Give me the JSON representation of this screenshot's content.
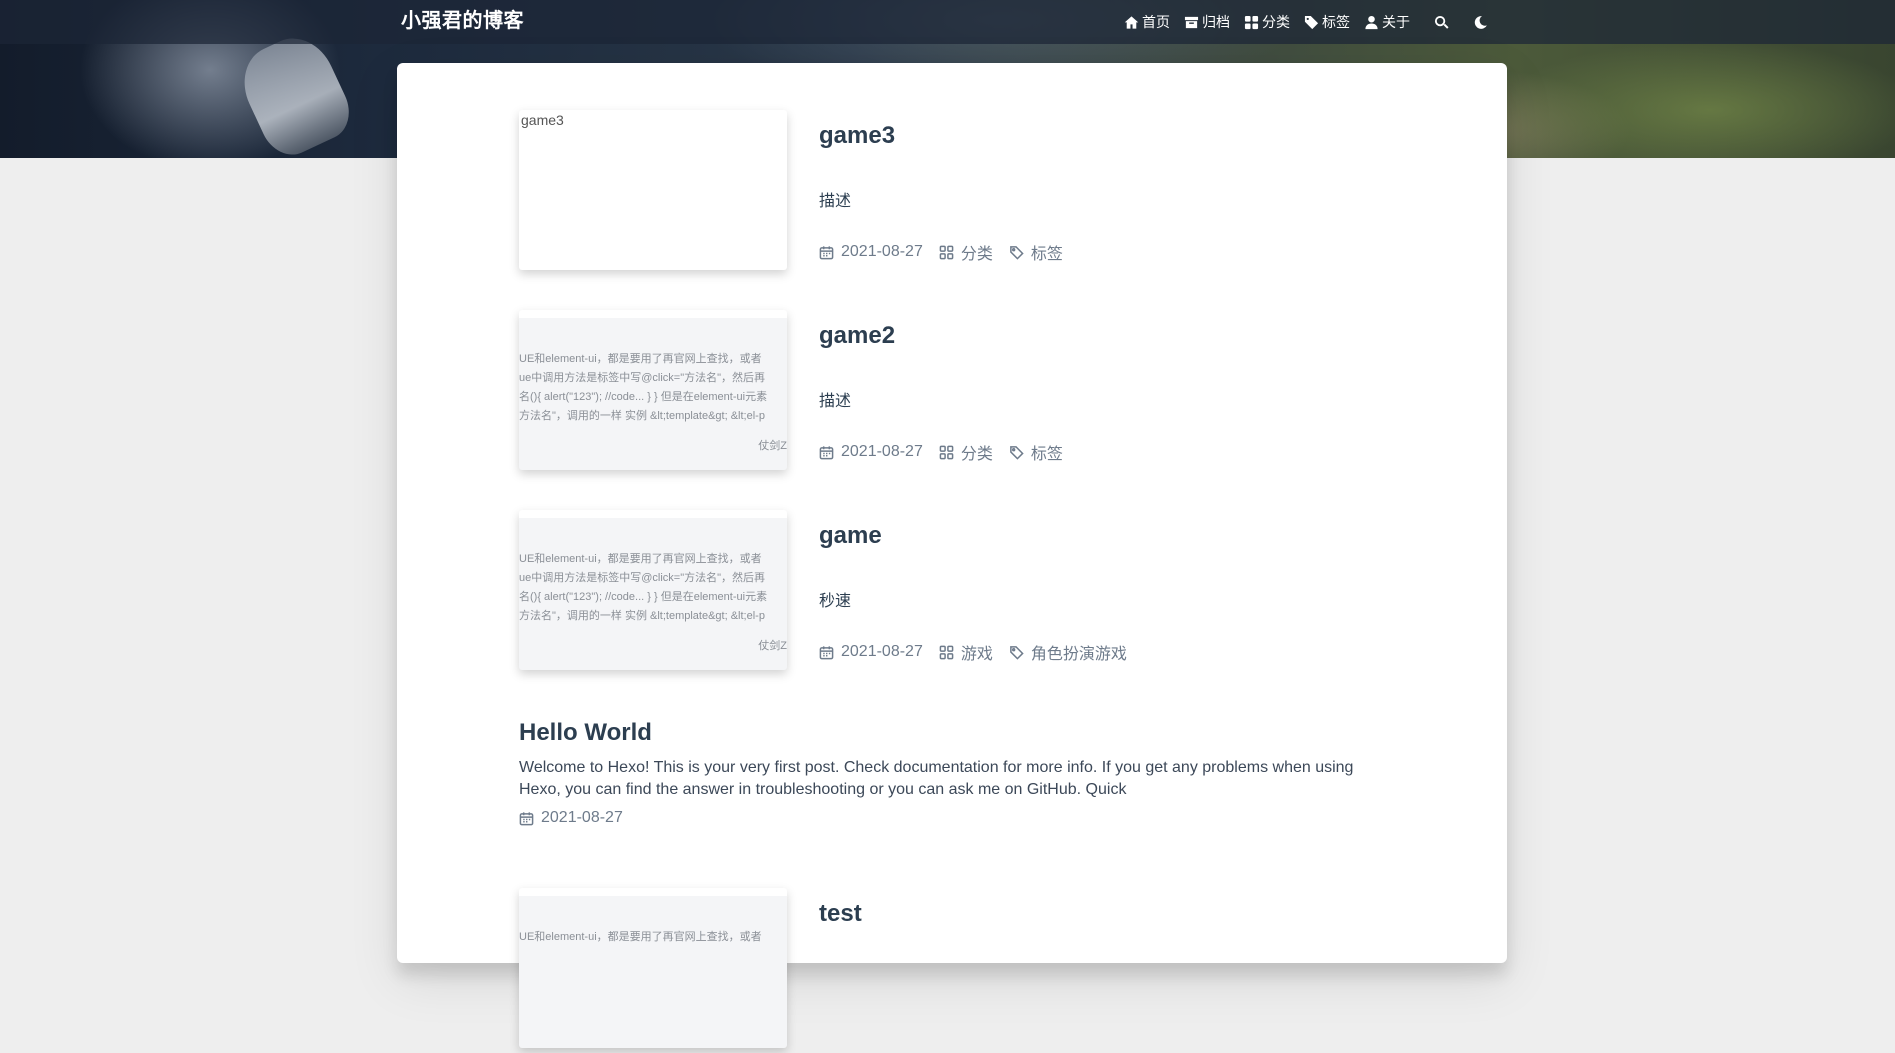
{
  "site": {
    "title": "小强君的博客"
  },
  "nav": {
    "items": [
      {
        "label": "首页",
        "icon": "home-icon"
      },
      {
        "label": "归档",
        "icon": "archive-icon"
      },
      {
        "label": "分类",
        "icon": "category-icon"
      },
      {
        "label": "标签",
        "icon": "tag-icon"
      },
      {
        "label": "关于",
        "icon": "user-icon"
      }
    ],
    "search_icon": "search-icon",
    "theme_icon": "moon-icon"
  },
  "posts": [
    {
      "title": "game3",
      "description": "描述",
      "date": "2021-08-27",
      "category": "分类",
      "tag": "标签",
      "thumb_alt": "game3"
    },
    {
      "title": "game2",
      "description": "描述",
      "date": "2021-08-27",
      "category": "分类",
      "tag": "标签",
      "thumb_lines": [
        "UE和element-ui，都是要用了再官网上查找，或者",
        "ue中调用方法是标签中写@click=\"方法名\"，然后再",
        "名(){ alert(\"123\"); //code... } } 但是在element-ui元素",
        "方法名\"，调用的一样 实例 &lt;template&gt; &lt;el-p"
      ],
      "thumb_author": "仗剑Z"
    },
    {
      "title": "game",
      "description": "秒速",
      "date": "2021-08-27",
      "category": "游戏",
      "tag": "角色扮演游戏",
      "thumb_lines": [
        "UE和element-ui，都是要用了再官网上查找，或者",
        "ue中调用方法是标签中写@click=\"方法名\"，然后再",
        "名(){ alert(\"123\"); //code... } } 但是在element-ui元素",
        "方法名\"，调用的一样 实例 &lt;template&gt; &lt;el-p"
      ],
      "thumb_author": "仗剑Z"
    },
    {
      "title": "Hello World",
      "excerpt": "Welcome to Hexo! This is your very first post. Check documentation for more info. If you get any problems when using Hexo, you can find the answer in troubleshooting or you can ask me on GitHub. Quick",
      "date": "2021-08-27"
    },
    {
      "title": "test",
      "thumb_lines": [
        "UE和element-ui，都是要用了再官网上查找，或者"
      ]
    }
  ]
}
